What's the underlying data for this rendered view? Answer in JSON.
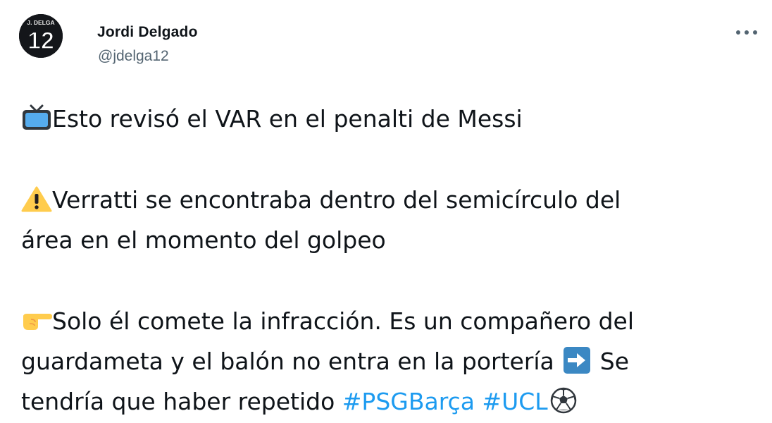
{
  "author": {
    "display_name": "Jordi Delgado",
    "handle": "@jdelga12",
    "avatar_text_top": "J. DELGA",
    "avatar_number": "12"
  },
  "menu": {
    "more_icon": "more-horizontal-icon"
  },
  "tweet": {
    "line1": "Esto revisó el VAR en el penalti de Messi",
    "line2": "Verratti se encontraba dentro del semicírculo del",
    "line3": "área en el momento del golpeo",
    "line4": "Solo él comete la infracción. Es un compañero del",
    "line5_a": "guardameta y el balón no entra en la portería",
    "line5_b": " Se",
    "line6": "tendría que haber repetido ",
    "hashtag1": "#PSGBarça",
    "hashtag2": "#UCL",
    "emoji_icons": [
      "tv-icon",
      "warning-icon",
      "backhand-index-pointing-right-icon",
      "right-arrow-icon",
      "soccer-ball-icon"
    ]
  },
  "colors": {
    "hashtag": "#1d9bf0",
    "text": "#0f1419",
    "secondary": "#536471"
  }
}
